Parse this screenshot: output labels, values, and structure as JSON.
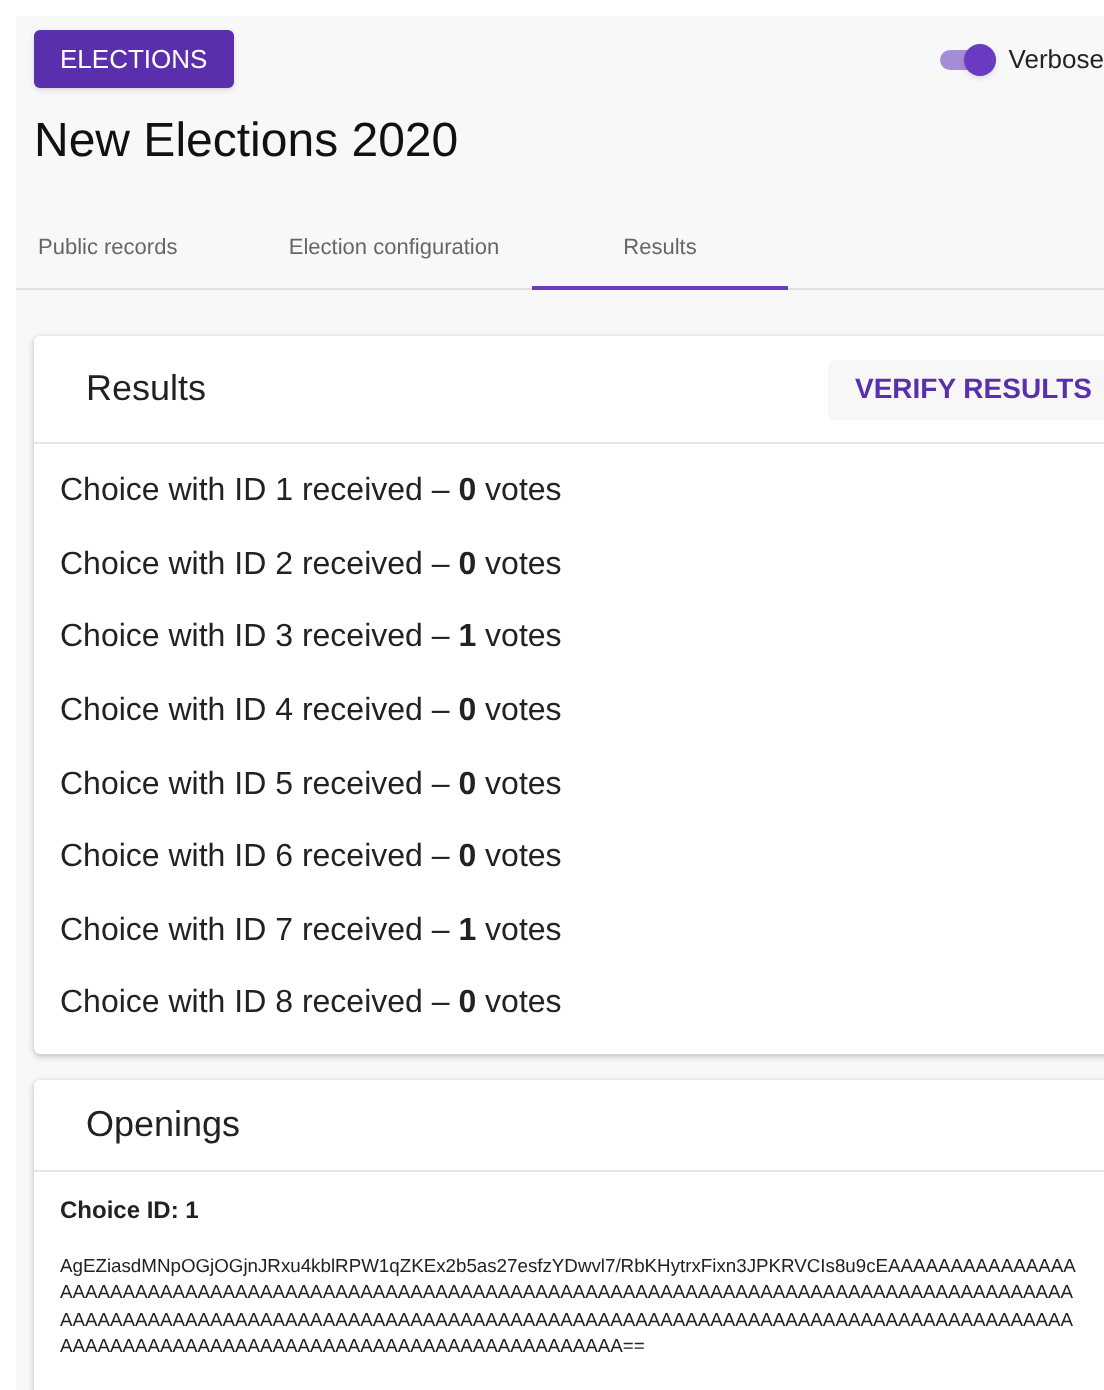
{
  "header": {
    "button": "ELECTIONS",
    "toggle": {
      "label": "Verbose",
      "on": true
    },
    "title": "New Elections 2020"
  },
  "tabs": [
    {
      "label": "Public records",
      "selected": false
    },
    {
      "label": "Election configuration",
      "selected": false
    },
    {
      "label": "Results",
      "selected": true
    }
  ],
  "results": {
    "title": "Results",
    "button": "VERIFY RESULTS",
    "rows": [
      {
        "text": "Choice with ID 1 received – **0** votes"
      },
      {
        "text": "Choice with ID 2 received – **0** votes"
      },
      {
        "text": "Choice with ID 3 received – **1** votes"
      },
      {
        "text": "Choice with ID 4 received – **0** votes"
      },
      {
        "text": "Choice with ID 5 received – **0** votes"
      },
      {
        "text": "Choice with ID 6 received – **0** votes"
      },
      {
        "text": "Choice with ID 7 received – **1** votes"
      },
      {
        "text": "Choice with ID 8 received – **0** votes"
      }
    ]
  },
  "openings": {
    "title": "Openings",
    "items": [
      {
        "label": "Choice ID: 1",
        "value": "AgEZiasdMNpOGjOGjnJRxu4kblRPW1qZKEx2b5as27esfzYDwvl7/RbKHytrxFixn3JPKRVCIs8u9cEAAAAAAAAAAAAAAAAAAAAAAAAAAAAAAAAAAAAAAAAAAAAAAAAAAAAAAAAAAAAAAAAAAAAAAAAAAAAAAAAAAAAAAAAAAAAAAAAAAAAAAAAAAAAAAAAAAAAAAAAAAAAAAAAAAAAAAAAAAAAAAAAAAAAAAAAAAAAAAAAAAAAAAAAAAAAAAAAAAAAAAAAAAAAAAAAAAAAAAAAAAAAAAAAAAAAAAAAAAAAAA=="
      }
    ]
  }
}
